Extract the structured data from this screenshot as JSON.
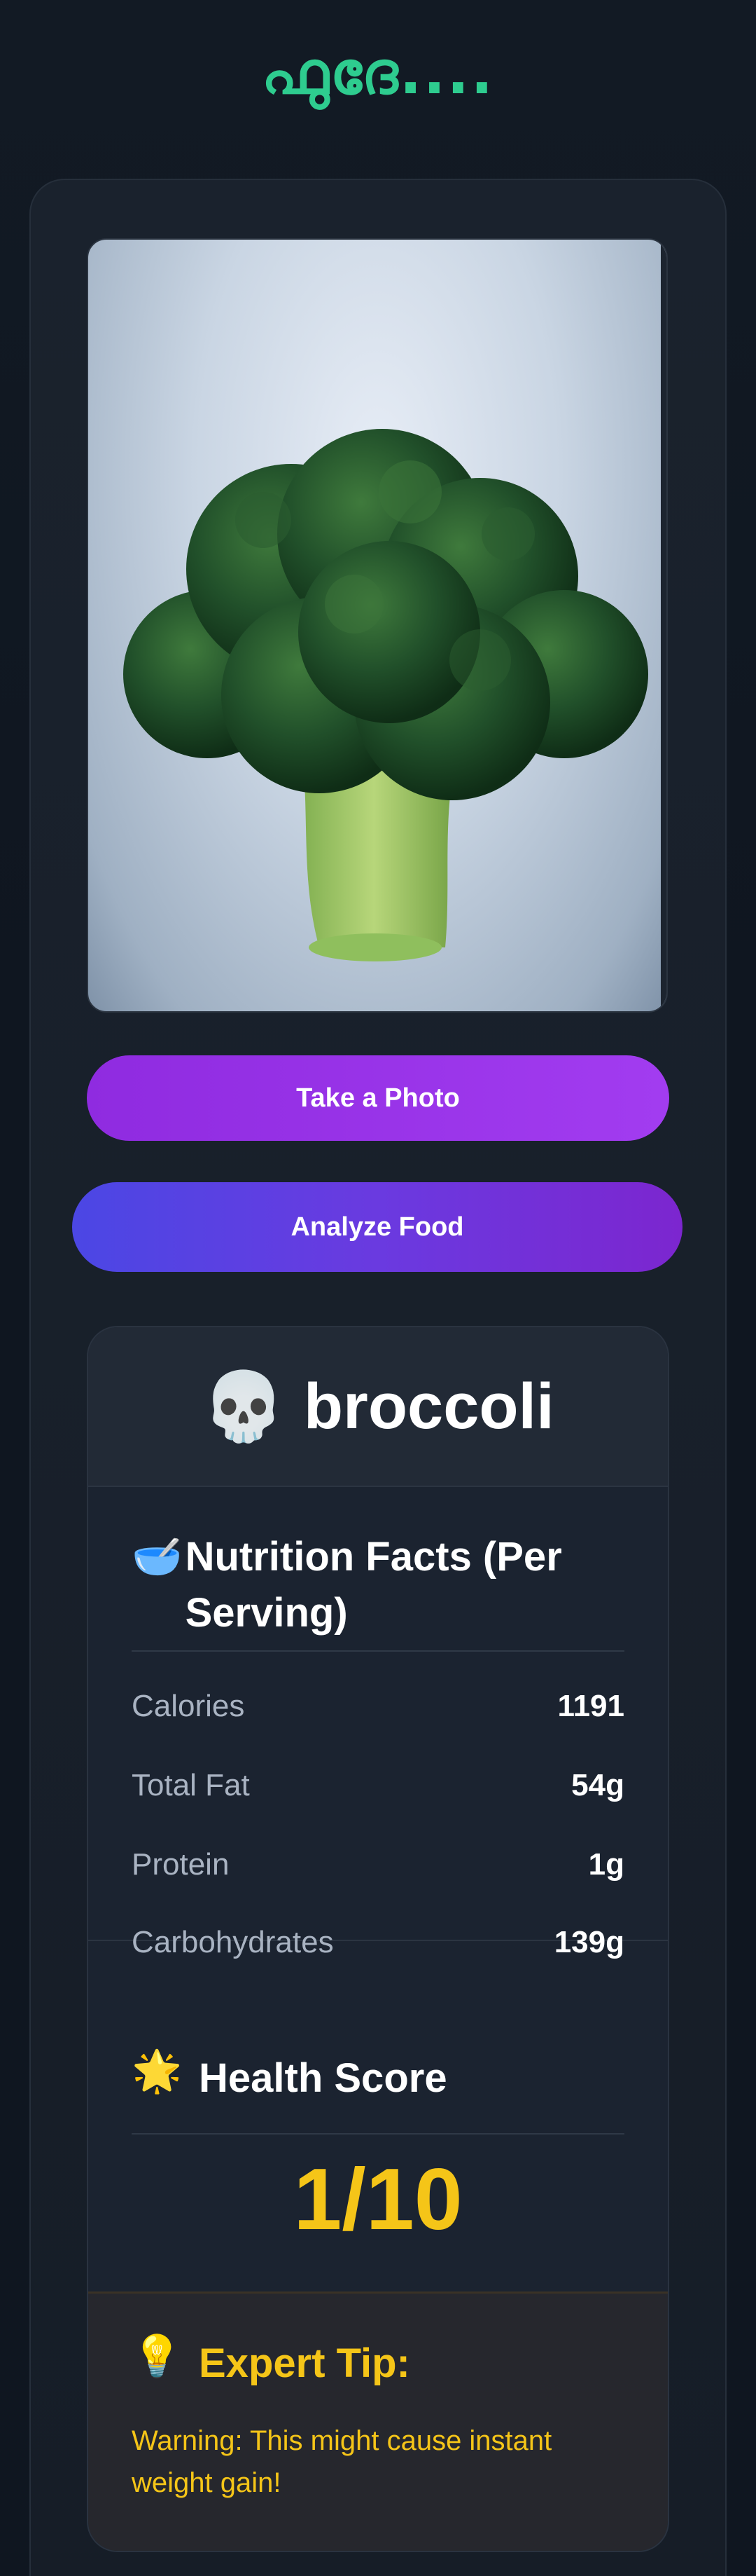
{
  "app": {
    "title": "ഫുദേ...."
  },
  "photo": {
    "subject": "broccoli photo"
  },
  "buttons": {
    "take_photo": "Take a Photo",
    "analyze": "Analyze Food"
  },
  "result": {
    "icon": "💀",
    "food_name": "broccoli",
    "nutrition": {
      "icon": "🥣",
      "title": "Nutrition Facts (Per Serving)",
      "rows": [
        {
          "label": "Calories",
          "value": "1191"
        },
        {
          "label": "Total Fat",
          "value": "54g"
        },
        {
          "label": "Protein",
          "value": "1g"
        },
        {
          "label": "Carbohydrates",
          "value": "139g"
        }
      ]
    },
    "health": {
      "icon": "🌟",
      "title": "Health Score",
      "score": "1/10"
    },
    "tip": {
      "icon": "💡",
      "title": "Expert Tip:",
      "text": "Warning: This might cause instant weight gain!"
    }
  },
  "colors": {
    "title_green": "#2ecc8f",
    "photo_button": "#9b35ea",
    "analyze_button_start": "#4b47e4",
    "analyze_button_end": "#7c26cf",
    "score_yellow": "#f5c518",
    "background": "#0f1620"
  }
}
